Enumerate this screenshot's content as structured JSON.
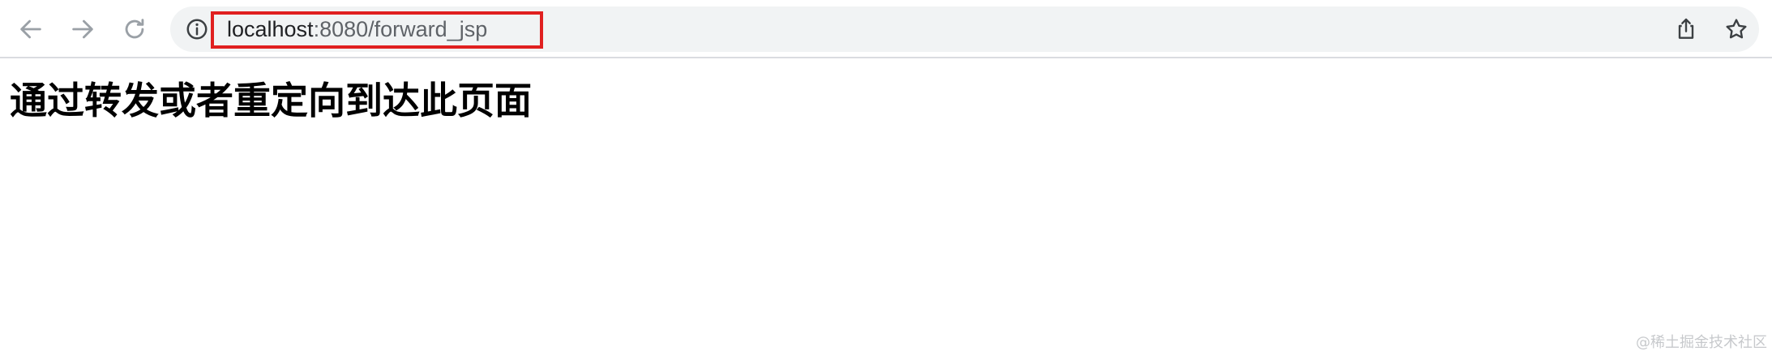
{
  "browser": {
    "url_host": "localhost",
    "url_rest": ":8080/forward_jsp",
    "icons": {
      "back": "back-arrow-icon",
      "forward": "forward-arrow-icon",
      "reload": "reload-icon",
      "info": "info-icon",
      "share": "share-icon",
      "bookmark": "star-icon"
    },
    "highlight_color": "#e02020"
  },
  "page": {
    "heading": "通过转发或者重定向到达此页面"
  },
  "watermark": {
    "text": "@稀土掘金技术社区"
  }
}
